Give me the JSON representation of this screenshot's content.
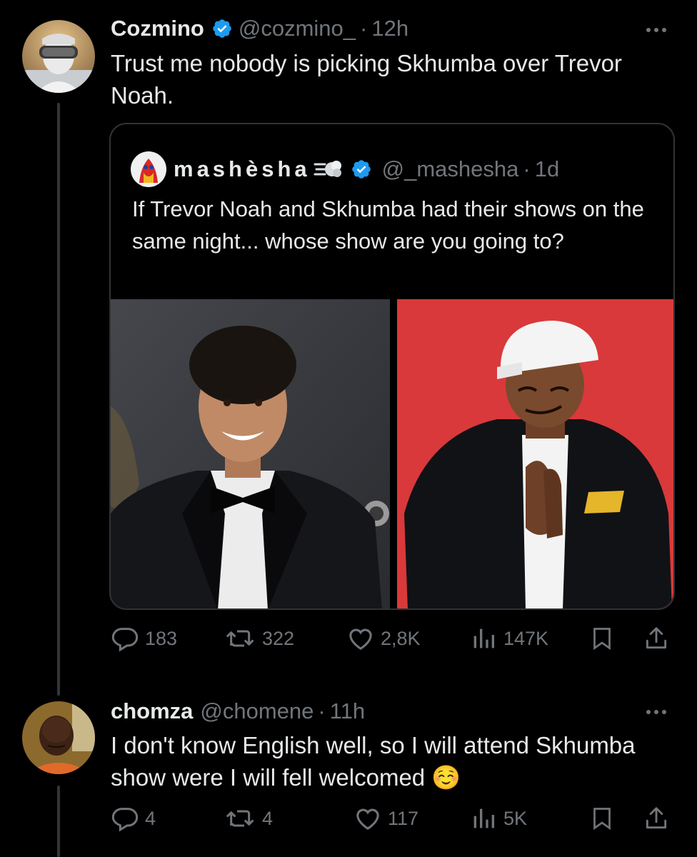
{
  "tweet1": {
    "name": "Cozmino",
    "handle": "@cozmino_",
    "separator": "·",
    "time": "12h",
    "text": "Trust me nobody is picking Skhumba over Trevor Noah.",
    "stats": {
      "replies": "183",
      "retweets": "322",
      "likes": "2,8K",
      "views": "147K"
    }
  },
  "quote": {
    "name": "mashèsha",
    "handle": "@_mashesha",
    "separator": "·",
    "time": "1d",
    "text": "If Trevor Noah and Skhumba had their shows on the same night... whose show are you going to?",
    "images": [
      "trevor-noah-photo",
      "skhumba-photo"
    ]
  },
  "tweet2": {
    "name": "chomza",
    "handle": "@chomene",
    "separator": "·",
    "time": "11h",
    "text": "I don't know English well, so I will attend Skhumba show were I will fell welcomed",
    "emoji": "☺️",
    "stats": {
      "replies": "4",
      "retweets": "4",
      "likes": "117",
      "views": "5K"
    }
  },
  "colors": {
    "background": "#000000",
    "text_primary": "#e7e9ea",
    "text_secondary": "#71767b",
    "verified": "#1d9bf0",
    "divider": "#2f3336"
  },
  "icons": [
    "reply-icon",
    "retweet-icon",
    "like-icon",
    "views-icon",
    "bookmark-icon",
    "share-icon",
    "verified-badge-icon",
    "more-icon",
    "dash-emoji-icon"
  ]
}
